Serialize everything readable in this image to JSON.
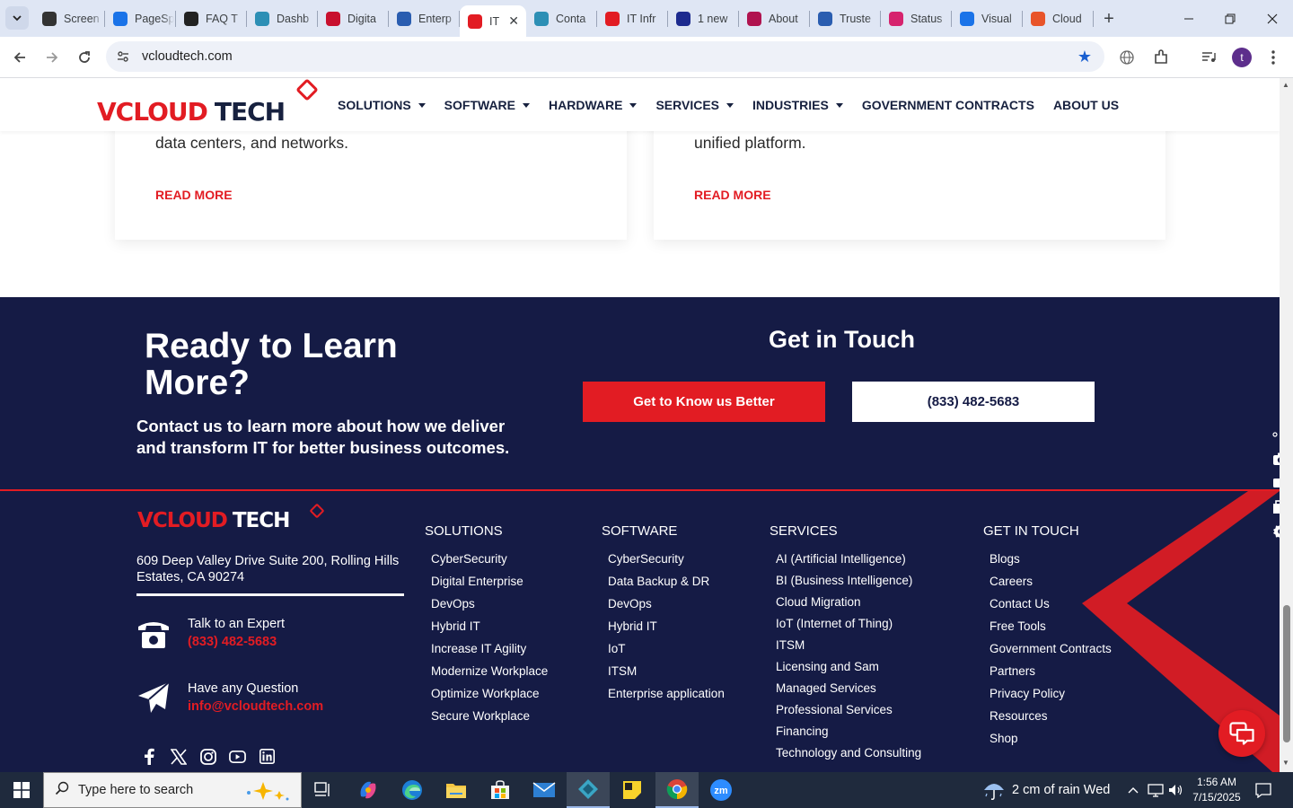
{
  "browser": {
    "tabs": [
      {
        "label": "Screen",
        "icon": "screencast-icon",
        "color": "#333333"
      },
      {
        "label": "PageSpeed",
        "icon": "pagespeed-icon",
        "color": "#1a73e8"
      },
      {
        "label": "FAQ T",
        "icon": "openai-icon",
        "color": "#222222"
      },
      {
        "label": "Dashb",
        "icon": "dashboard-icon",
        "color": "#2d8fb5"
      },
      {
        "label": "Digita",
        "icon": "verizon-icon",
        "color": "#c8102e"
      },
      {
        "label": "Enterp",
        "icon": "pen-icon",
        "color": "#2a5db0"
      },
      {
        "label": "IT",
        "icon": "vcloud-icon",
        "color": "#e21c23",
        "active": true
      },
      {
        "label": "Conta",
        "icon": "contact-icon",
        "color": "#2d8fb5"
      },
      {
        "label": "IT Infr",
        "icon": "vcloud-icon",
        "color": "#e21c23"
      },
      {
        "label": "1 new",
        "icon": "x-logo-icon",
        "color": "#1d2b8f"
      },
      {
        "label": "About",
        "icon": "about-icon",
        "color": "#b0134f"
      },
      {
        "label": "Truste",
        "icon": "scales-icon",
        "color": "#2a5db0"
      },
      {
        "label": "Status",
        "icon": "status-icon",
        "color": "#d6246e"
      },
      {
        "label": "Visual",
        "icon": "pulse-icon",
        "color": "#1a73e8"
      },
      {
        "label": "Cloud",
        "icon": "cloud-brand-icon",
        "color": "#e8542a"
      }
    ],
    "close_tab": "✕",
    "new_tab": "+",
    "url": "vcloudtech.com",
    "profile_initial": "t"
  },
  "site": {
    "logo": {
      "v": "V",
      "cloud": "CLOUD",
      "tech": "TECH"
    },
    "nav": [
      {
        "label": "SOLUTIONS",
        "dropdown": true
      },
      {
        "label": "SOFTWARE",
        "dropdown": true
      },
      {
        "label": "HARDWARE",
        "dropdown": true
      },
      {
        "label": "SERVICES",
        "dropdown": true
      },
      {
        "label": "INDUSTRIES",
        "dropdown": true
      },
      {
        "label": "GOVERNMENT CONTRACTS",
        "dropdown": false
      },
      {
        "label": "ABOUT US",
        "dropdown": false
      }
    ],
    "cards": [
      {
        "text": "data centers, and networks.",
        "read_more": "READ MORE"
      },
      {
        "text": "unified platform.",
        "read_more": "READ MORE"
      }
    ],
    "cta": {
      "title": "Ready to Learn More?",
      "text": "Contact us to learn more about how we deliver and transform IT for better business outcomes.",
      "get_in_touch": "Get in Touch",
      "primary_button": "Get to Know us Better",
      "phone_button": "(833) 482-5683"
    },
    "footer": {
      "address": "609 Deep Valley Drive Suite 200, Rolling Hills Estates, CA 90274",
      "talk_label": "Talk to an Expert",
      "talk_value": "(833) 482-5683",
      "question_label": "Have any Question",
      "question_value": "info@vcloudtech.com",
      "columns": [
        {
          "heading": "SOLUTIONS",
          "links": [
            "CyberSecurity",
            "Digital Enterprise",
            "DevOps",
            "Hybrid IT",
            "Increase IT Agility",
            "Modernize Workplace",
            "Optimize Workplace",
            "Secure Workplace"
          ]
        },
        {
          "heading": "SOFTWARE",
          "links": [
            "CyberSecurity",
            "Data Backup & DR",
            "DevOps",
            "Hybrid IT",
            "IoT",
            "ITSM",
            "Enterprise application"
          ]
        },
        {
          "heading": "SERVICES",
          "links": [
            "AI (Artificial Intelligence)",
            "BI (Business Intelligence)",
            "Cloud Migration",
            "IoT (Internet of Thing)",
            "ITSM",
            "Licensing and Sam",
            "Managed Services",
            "Professional Services",
            "Financing",
            "Technology and Consulting"
          ]
        },
        {
          "heading": "GET IN TOUCH",
          "links": [
            "Blogs",
            "Careers",
            "Contact Us",
            "Free Tools",
            "Government Contracts",
            "Partners",
            "Privacy Policy",
            "Resources",
            "Shop"
          ]
        }
      ]
    }
  },
  "taskbar": {
    "search_placeholder": "Type here to search",
    "weather": "2 cm of rain Wed",
    "time": "1:56 AM",
    "date": "7/15/2025"
  },
  "colors": {
    "brand_red": "#e21c23",
    "navy": "#151b45"
  }
}
